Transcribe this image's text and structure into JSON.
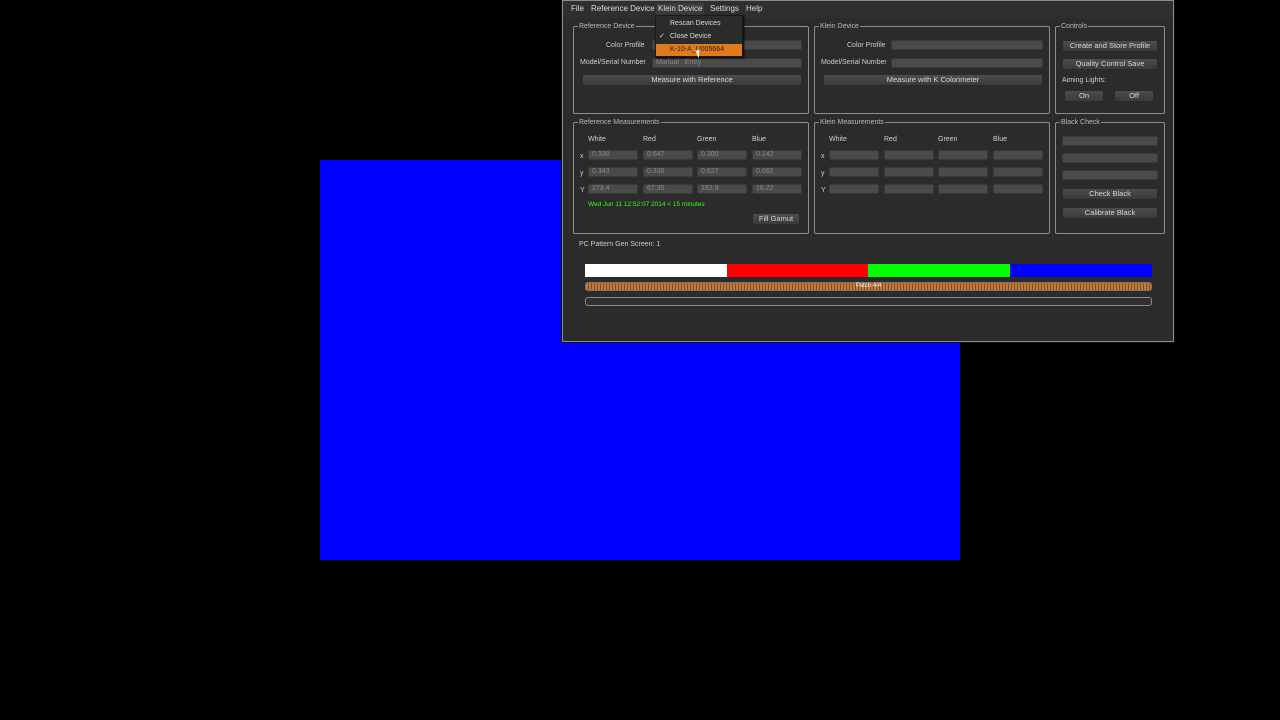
{
  "menubar": {
    "file": "File",
    "reference_device": "Reference Device",
    "klein_device": "Klein Device",
    "settings": "Settings",
    "help": "Help"
  },
  "dropdown": {
    "rescan": "Rescan Devices",
    "close": "Close Device",
    "device": "K-10-A_U005664",
    "checkmark": "✓"
  },
  "reference_device": {
    "title": "Reference Device",
    "color_profile_label": "Color Profile",
    "model_label": "Model/Serial Number",
    "model_value": "Manual : Entry",
    "measure_button": "Measure with Reference"
  },
  "klein_device": {
    "title": "Klein Device",
    "color_profile_label": "Color Profile",
    "model_label": "Model/Serial Number",
    "measure_button": "Measure with K Colorimeter"
  },
  "controls": {
    "title": "Controls",
    "create_store": "Create and Store Profile",
    "quality_control": "Quality Control Save",
    "aiming_lights": "Aiming Lights:",
    "on": "On",
    "off": "Off"
  },
  "reference_measurements": {
    "title": "Reference Measurements",
    "columns": [
      "White",
      "Red",
      "Green",
      "Blue"
    ],
    "rows": [
      "x",
      "y",
      "Y"
    ],
    "values": [
      [
        "0.330",
        "0.647",
        "0.300",
        "0.142"
      ],
      [
        "0.343",
        "0.336",
        "0.627",
        "0.062"
      ],
      [
        "273.4",
        "67.35",
        "182.9",
        "18.22"
      ]
    ],
    "timestamp": "Wed Jun 11 12:52:07 2014 < 15 minutes",
    "fill_gamut": "Fill Gamut"
  },
  "klein_measurements": {
    "title": "Klein Measurements",
    "columns": [
      "White",
      "Red",
      "Green",
      "Blue"
    ],
    "rows": [
      "x",
      "y",
      "Y"
    ]
  },
  "black_check": {
    "title": "Black Check",
    "check_black": "Check Black",
    "calibrate_black": "Calibrate Black"
  },
  "pattern": {
    "label": "PC Pattern Gen  Screen: 1",
    "swatches": [
      "#ffffff",
      "#ff0000",
      "#00ff00",
      "#0000ff"
    ],
    "patch_text": "Patch 4/4"
  },
  "colors": {
    "screen_blue": "#0000ff",
    "highlight": "#e07a1b",
    "timestamp_green": "#39ff14"
  }
}
